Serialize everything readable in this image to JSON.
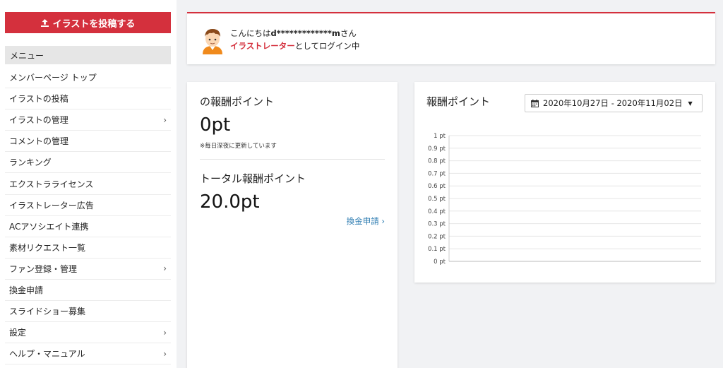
{
  "sidebar": {
    "post_button": "イラストを投稿する",
    "menu_header": "メニュー",
    "items": [
      {
        "label": "メンバーページ トップ",
        "has_submenu": false
      },
      {
        "label": "イラストの投稿",
        "has_submenu": false
      },
      {
        "label": "イラストの管理",
        "has_submenu": true
      },
      {
        "label": "コメントの管理",
        "has_submenu": false
      },
      {
        "label": "ランキング",
        "has_submenu": false
      },
      {
        "label": "エクストラライセンス",
        "has_submenu": false
      },
      {
        "label": "イラストレーター広告",
        "has_submenu": false
      },
      {
        "label": "ACアソシエイト連携",
        "has_submenu": false
      },
      {
        "label": "素材リクエスト一覧",
        "has_submenu": false
      },
      {
        "label": "ファン登録・管理",
        "has_submenu": true
      },
      {
        "label": "換金申請",
        "has_submenu": false
      },
      {
        "label": "スライドショー募集",
        "has_submenu": false
      },
      {
        "label": "設定",
        "has_submenu": true
      },
      {
        "label": "ヘルプ・マニュアル",
        "has_submenu": true
      }
    ],
    "chevron": "›"
  },
  "welcome": {
    "greeting_prefix": "こんにちは",
    "username": "d*************m",
    "greeting_suffix": "さん",
    "role": "イラストレーター",
    "login_suffix": "としてログイン中"
  },
  "points": {
    "current_title": "の報酬ポイント",
    "current_value": "0pt",
    "note": "※毎日深夜に更新しています",
    "total_title": "トータル報酬ポイント",
    "total_value": "20.0pt",
    "exchange_link": "換金申請 ›"
  },
  "chart_panel": {
    "title": "報酬ポイント",
    "date_range": "2020年10月27日 - 2020年11月02日"
  },
  "chart_data": {
    "type": "line",
    "title": "報酬ポイント",
    "xlabel": "",
    "ylabel": "",
    "ylim": [
      0,
      1
    ],
    "y_ticks": [
      "0 pt",
      "0.1 pt",
      "0.2 pt",
      "0.3 pt",
      "0.4 pt",
      "0.5 pt",
      "0.6 pt",
      "0.7 pt",
      "0.8 pt",
      "0.9 pt",
      "1 pt"
    ],
    "y_tick_values": [
      0,
      0.1,
      0.2,
      0.3,
      0.4,
      0.5,
      0.6,
      0.7,
      0.8,
      0.9,
      1
    ],
    "grid": true,
    "series": []
  },
  "colors": {
    "accent": "#d4303d",
    "link": "#2a7ab0"
  }
}
